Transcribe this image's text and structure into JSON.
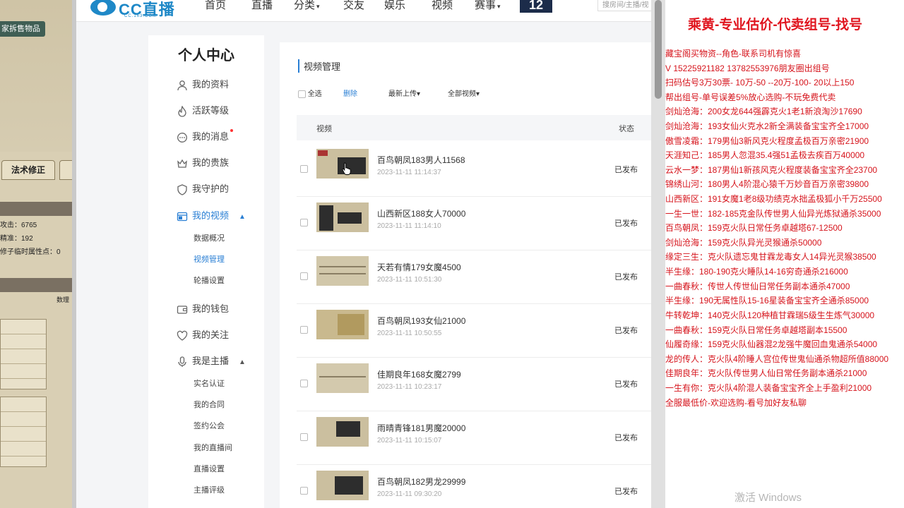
{
  "game": {
    "sell_button": "家拆售物品",
    "tabs": [
      "法术修正"
    ],
    "stats": [
      "攻击：6765",
      "精准：192",
      "修子临时属性点：0"
    ],
    "column_label": "数理"
  },
  "nav": {
    "logo_text": "CC直播",
    "logo_sub": "CC.163.COM",
    "items": [
      "首页",
      "直播",
      "分类",
      "交友",
      "娱乐",
      "视频",
      "赛事"
    ],
    "badge": "12",
    "search_placeholder": "搜房间/主播/视"
  },
  "sidebar": {
    "title": "个人中心",
    "items": [
      {
        "label": "我的资料",
        "icon": "user-icon"
      },
      {
        "label": "活跃等级",
        "icon": "flame-icon"
      },
      {
        "label": "我的消息",
        "icon": "message-icon"
      },
      {
        "label": "我的贵族",
        "icon": "crown-icon"
      },
      {
        "label": "我守护的",
        "icon": "shield-icon"
      },
      {
        "label": "我的视频",
        "icon": "video-icon"
      },
      {
        "label": "我的钱包",
        "icon": "wallet-icon"
      },
      {
        "label": "我的关注",
        "icon": "heart-icon"
      },
      {
        "label": "我是主播",
        "icon": "microphone-icon"
      }
    ],
    "video_sub": [
      "数据概况",
      "视频管理",
      "轮播设置"
    ],
    "anchor_sub": [
      "实名认证",
      "我的合同",
      "签约公会",
      "我的直播间",
      "直播设置",
      "主播评级"
    ]
  },
  "content": {
    "section_title": "视频管理",
    "select_all": "全选",
    "delete": "删除",
    "sort": "最新上传",
    "filter": "全部视频",
    "col_video": "视频",
    "col_status": "状态",
    "videos": [
      {
        "title": "百鸟朝凤183男人11568",
        "time": "2023-11-11 11:14:37",
        "status": "已发布"
      },
      {
        "title": "山西新区188女人70000",
        "time": "2023-11-11 11:14:10",
        "status": "已发布"
      },
      {
        "title": "天若有情179女魔4500",
        "time": "2023-11-11 10:51:30",
        "status": "已发布"
      },
      {
        "title": "百鸟朝凤193女仙21000",
        "time": "2023-11-11 10:50:55",
        "status": "已发布"
      },
      {
        "title": "佳期良年168女魔2799",
        "time": "2023-11-11 10:23:17",
        "status": "已发布"
      },
      {
        "title": "雨晴青锋181男魔20000",
        "time": "2023-11-11 10:15:07",
        "status": "已发布"
      },
      {
        "title": "百鸟朝凤182男龙29999",
        "time": "2023-11-11 09:30:20",
        "status": "已发布"
      }
    ]
  },
  "overlay": {
    "heading": "乘黄-专业估价-代卖组号-找号",
    "lines": [
      "藏宝阁买物资--角色-联系司机有惊喜",
      "V 15225921182  13782553976朋友圈出组号",
      "扫码估号3万30票- 10万-50 --20万-100- 20以上150",
      "帮出组号-单号误差5%放心选购-不玩免费代卖",
      "剑灿沧海：200女龙644强霹克火1老1新浪淘沙17690",
      "剑灿沧海：193女仙火克水2新全满装备宝宝齐全17000",
      "傲雪凌霜：179男仙3新风克火程度孟极百万亲密21900",
      "天涯知己：185男人忽混35.4强51孟极去疾百万40000",
      "云水一梦：187男仙1新孩风克火程度装备宝宝齐全23700",
      "锦绣山河：180男人4阶混心猿千万妙音百万亲密39800",
      "山西新区：191女魔1老8级功绩克水拙孟极狐小千万25500",
      "一生一世：182-185克金队传世男人仙异光炼狱通杀35000",
      "百鸟朝凤：159克火队日常任务卓越塔67-12500",
      "剑灿沧海：159克火队异光灵猴通杀50000",
      "缘定三生：克火队遗忘鬼甘霖龙毒女人14异光灵猴38500",
      "半生缘：180-190克火睡队14-16穷奇通杀216000",
      "一曲春秋：传世人传世仙日常任务副本通杀47000",
      "半生缘：190无属性队15-16星装备宝宝齐全通杀85000",
      "牛转乾坤：140克火队120种植甘霖瑞5级生生炼气30000",
      "一曲春秋：159克火队日常任务卓越塔副本15500",
      "仙履奇缘：159克火队仙器混2龙强牛魔回血鬼通杀54000",
      "龙的传人：克火队4阶睡人宫位传世鬼仙通杀物超所值88000",
      "佳期良年：克火队传世男人仙日常任务副本通杀21000",
      "一生有你：克火队4阶混人装备宝宝齐全上手盈利21000",
      "全服最低价-欢迎选购-看号加好友私聊"
    ]
  },
  "watermark": "激活 Windows"
}
